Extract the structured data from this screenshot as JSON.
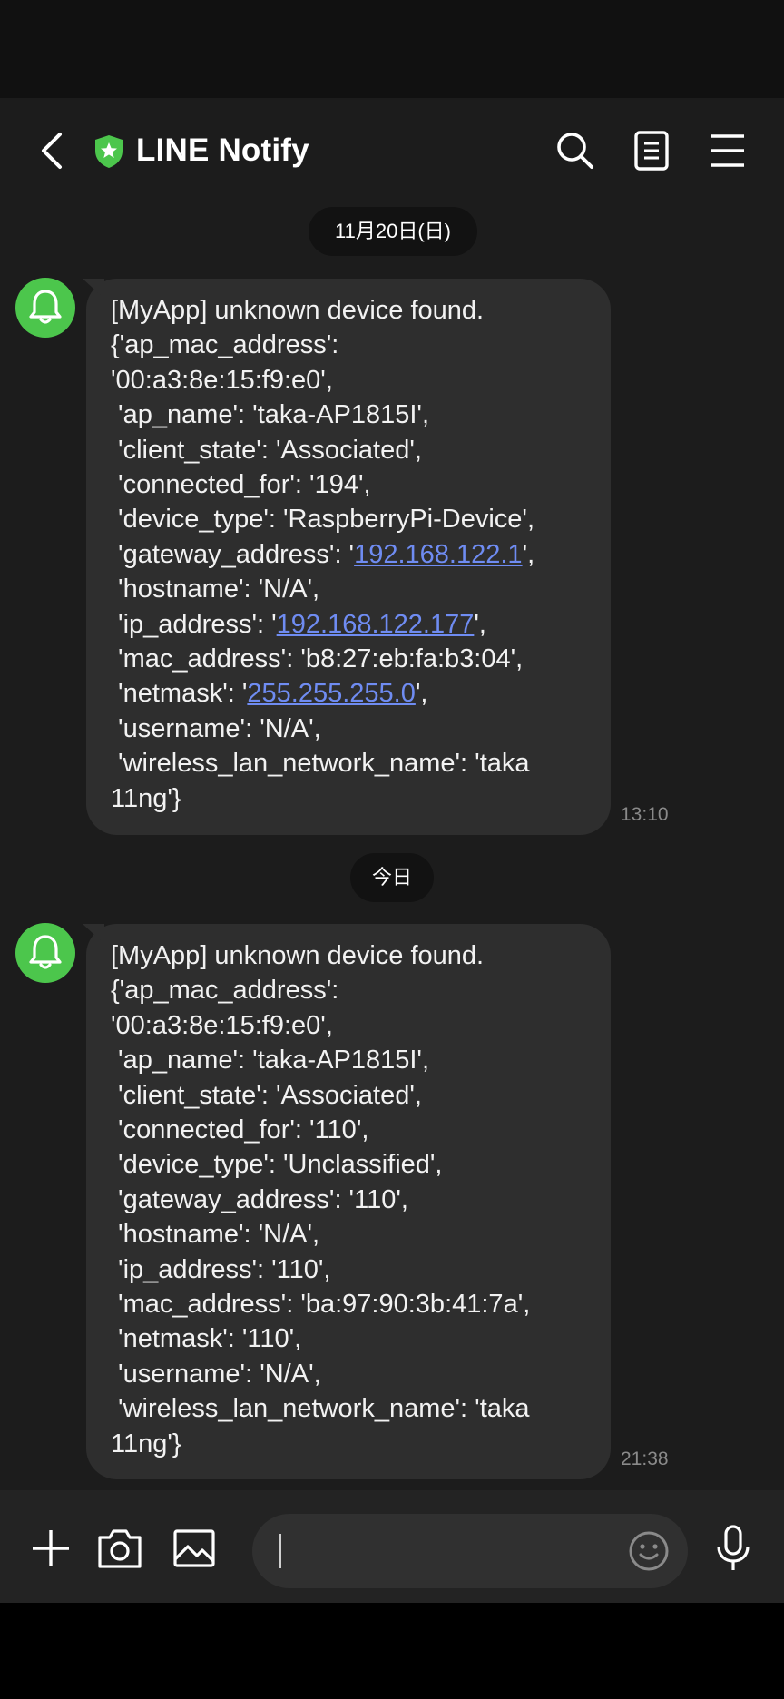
{
  "header": {
    "title": "LINE Notify",
    "accent": "#4cc64c"
  },
  "icons": {
    "back": "chevron-left-icon",
    "verified": "shield-star-icon",
    "search": "search-icon",
    "notes": "notes-icon",
    "menu": "menu-icon",
    "avatar": "bell-icon",
    "plus": "plus-icon",
    "camera": "camera-icon",
    "image": "image-icon",
    "emoji": "emoji-icon",
    "mic": "microphone-icon"
  },
  "chat": {
    "dates": [
      "11月20日(日)",
      "今日"
    ],
    "messages": [
      {
        "time": "13:10",
        "parts": [
          "[MyApp] unknown device found.\n{'ap_mac_address':\n'00:a3:8e:15:f9:e0',\n 'ap_name': 'taka-AP1815I',\n 'client_state': 'Associated',\n 'connected_for': '194',\n 'device_type': 'RaspberryPi-Device',\n 'gateway_address': '",
          "192.168.122.1",
          "',\n 'hostname': 'N/A',\n 'ip_address': '",
          "192.168.122.177",
          "',\n 'mac_address': 'b8:27:eb:fa:b3:04',\n 'netmask': '",
          "255.255.255.0",
          "',\n 'username': 'N/A',\n 'wireless_lan_network_name': 'taka\n11ng'}"
        ]
      },
      {
        "time": "21:38",
        "text": "[MyApp] unknown device found.\n{'ap_mac_address':\n'00:a3:8e:15:f9:e0',\n 'ap_name': 'taka-AP1815I',\n 'client_state': 'Associated',\n 'connected_for': '110',\n 'device_type': 'Unclassified',\n 'gateway_address': '110',\n 'hostname': 'N/A',\n 'ip_address': '110',\n 'mac_address': 'ba:97:90:3b:41:7a',\n 'netmask': '110',\n 'username': 'N/A',\n 'wireless_lan_network_name': 'taka\n11ng'}"
      }
    ]
  },
  "input": {
    "value": ""
  }
}
